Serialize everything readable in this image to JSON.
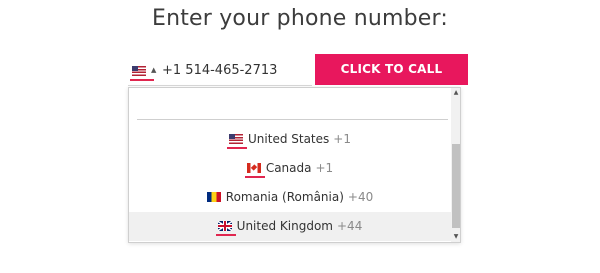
{
  "heading": "Enter your phone number:",
  "phone": {
    "selected_flag": "us-flag-icon",
    "value": "+1 514-465-2713"
  },
  "call_button": {
    "label": "CLICK TO CALL",
    "color": "#e8175d"
  },
  "dropdown": {
    "search_value": "",
    "options": [
      {
        "name": "United States",
        "code": "+1",
        "flag": "us-flag-icon",
        "highlighted": false
      },
      {
        "name": "Canada",
        "code": "+1",
        "flag": "ca-flag-icon",
        "highlighted": false
      },
      {
        "name": "Romania (România)",
        "code": "+40",
        "flag": "ro-flag-icon",
        "highlighted": false
      },
      {
        "name": "United Kingdom",
        "code": "+44",
        "flag": "gb-flag-icon",
        "highlighted": true
      }
    ]
  },
  "accent_underline_color": "#e0264f"
}
